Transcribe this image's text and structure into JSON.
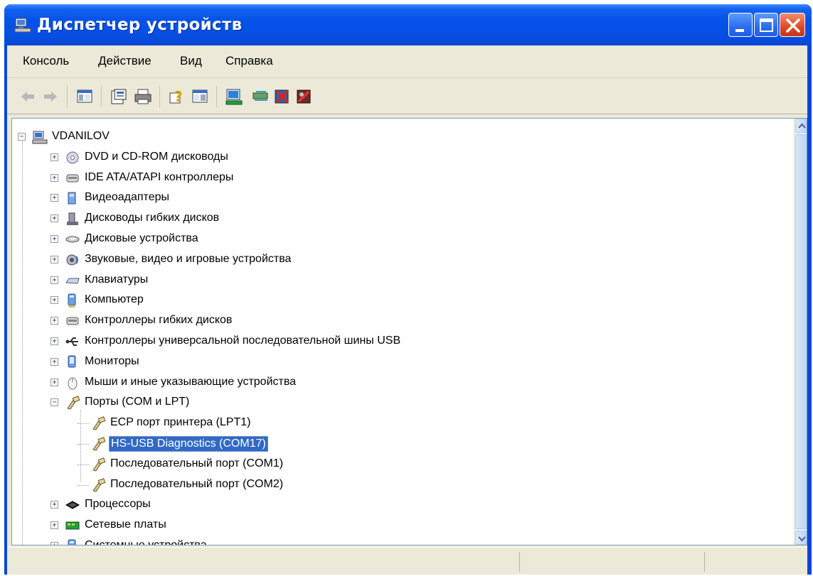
{
  "window": {
    "title": "Диспетчер устройств",
    "title_icon": "device-manager-icon",
    "buttons": [
      "minimize-icon",
      "maximize-icon",
      "close-icon"
    ]
  },
  "menu": {
    "items": [
      "Консоль",
      "Действие",
      "Вид",
      "Справка"
    ]
  },
  "toolbar": {
    "tools": [
      "back-arrow-icon",
      "forward-arrow-icon",
      "show-hide-tree-icon",
      "properties-icon",
      "print-icon",
      "help-icon",
      "show-hide-pane-icon",
      "scan-hardware-icon",
      "update-driver-icon",
      "disable-device-icon",
      "uninstall-device-icon"
    ]
  },
  "tree": {
    "root": {
      "label": "VDANILOV",
      "icon": "computer-icon",
      "expanded": true
    },
    "categories": [
      {
        "label": "DVD и CD-ROM дисководы",
        "icon": "cdrom-icon",
        "expanded": false
      },
      {
        "label": "IDE ATA/ATAPI контроллеры",
        "icon": "ide-controller-icon",
        "expanded": false
      },
      {
        "label": "Видеоадаптеры",
        "icon": "display-adapter-icon",
        "expanded": false
      },
      {
        "label": "Дисководы гибких дисков",
        "icon": "floppy-drive-icon",
        "expanded": false
      },
      {
        "label": "Дисковые устройства",
        "icon": "disk-drive-icon",
        "expanded": false
      },
      {
        "label": "Звуковые, видео и игровые устройства",
        "icon": "sound-icon",
        "expanded": false
      },
      {
        "label": "Клавиатуры",
        "icon": "keyboard-icon",
        "expanded": false
      },
      {
        "label": "Компьютер",
        "icon": "computer-device-icon",
        "expanded": false
      },
      {
        "label": "Контроллеры гибких дисков",
        "icon": "floppy-controller-icon",
        "expanded": false
      },
      {
        "label": "Контроллеры универсальной последовательной шины USB",
        "icon": "usb-icon",
        "expanded": false
      },
      {
        "label": "Мониторы",
        "icon": "monitor-icon",
        "expanded": false
      },
      {
        "label": "Мыши и иные указывающие устройства",
        "icon": "mouse-icon",
        "expanded": false
      },
      {
        "label": "Порты (COM и LPT)",
        "icon": "port-icon",
        "expanded": true,
        "children": [
          {
            "label": "ECP порт принтера (LPT1)",
            "icon": "port-icon",
            "selected": false
          },
          {
            "label": "HS-USB Diagnostics (COM17)",
            "icon": "port-icon",
            "selected": true
          },
          {
            "label": "Последовательный порт (COM1)",
            "icon": "port-icon",
            "selected": false
          },
          {
            "label": "Последовательный порт (COM2)",
            "icon": "port-icon",
            "selected": false
          }
        ]
      },
      {
        "label": "Процессоры",
        "icon": "processor-icon",
        "expanded": false
      },
      {
        "label": "Сетевые платы",
        "icon": "network-card-icon",
        "expanded": false
      },
      {
        "label": "Системные устройства",
        "icon": "system-device-icon",
        "expanded": false
      }
    ]
  },
  "colors": {
    "titlebar": "#0552e8",
    "selection": "#316ac5",
    "face": "#ece9d8"
  }
}
